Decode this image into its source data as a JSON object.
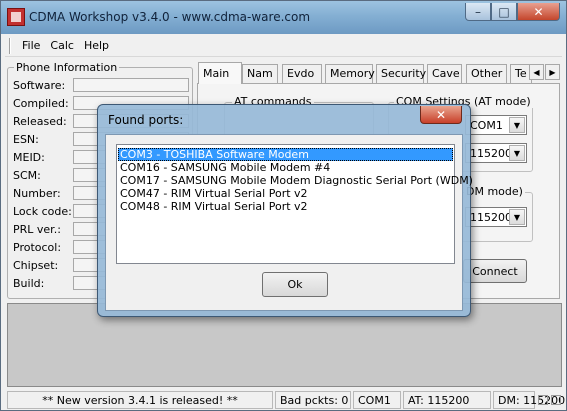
{
  "window": {
    "title": "CDMA Workshop v3.4.0  -  www.cdma-ware.com",
    "buttons": {
      "minimize": "–",
      "maximize": "□",
      "close": "✕"
    }
  },
  "menu": [
    "File",
    "Calc",
    "Help"
  ],
  "phone_info": {
    "title": "Phone Information",
    "fields": [
      "Software:",
      "Compiled:",
      "Released:",
      "ESN:",
      "MEID:",
      "SCM:",
      "Number:",
      "Lock code:",
      "PRL ver.:",
      "Protocol:",
      "Chipset:",
      "Build:"
    ]
  },
  "tabs": {
    "items": [
      "Main",
      "Nam",
      "Evdo",
      "Memory",
      "Security",
      "Cave",
      "Other",
      "Te"
    ],
    "active": "Main",
    "scroll_left": "◀",
    "scroll_right": "▶"
  },
  "main_tab": {
    "at_commands_label": "AT commands",
    "com_settings_label": "COM Settings (AT mode)",
    "com_port_value": "COM1",
    "baud_value": "115200",
    "dm_mode_label": "DM mode)",
    "dm_baud_value": "115200",
    "connect_label": "Connect"
  },
  "status_bar": {
    "message": "**  New version 3.4.1 is released!  **",
    "bad_packets": "Bad pckts: 0",
    "port": "COM1",
    "at_baud": "AT: 115200",
    "dm_baud": "DM: 115200"
  },
  "dialog": {
    "title": "Found ports:",
    "close_glyph": "✕",
    "ports": [
      "COM3  -  TOSHIBA Software Modem",
      "COM16  -  SAMSUNG Mobile Modem #4",
      "COM17  -  SAMSUNG Mobile Modem Diagnostic Serial Port (WDM)",
      "COM47  -  RIM Virtual Serial Port v2",
      "COM48  -  RIM Virtual Serial Port v2"
    ],
    "selected_index": 0,
    "ok_label": "Ok"
  },
  "colors": {
    "selection": "#3399ff",
    "close_button": "#c8402a",
    "title_bar": "#84afd3"
  }
}
